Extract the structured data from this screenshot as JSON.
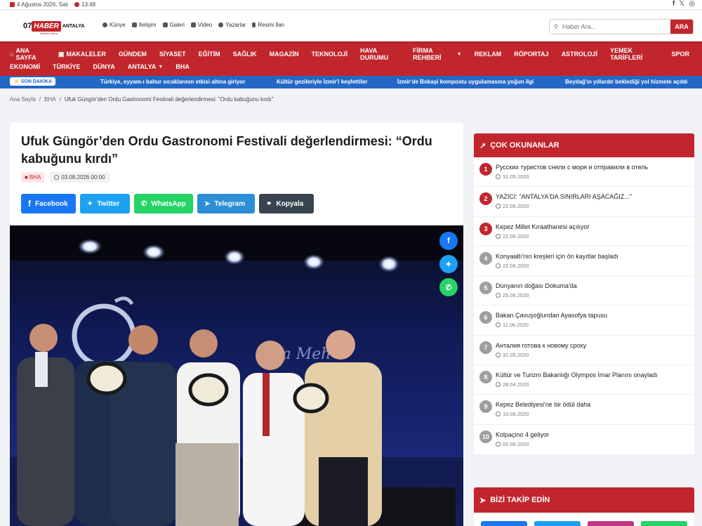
{
  "topbar": {
    "date": "4 Ağustos 2026, Salı",
    "time": "13:48"
  },
  "social_top": [
    "f",
    "𝕏",
    "◎"
  ],
  "logo": {
    "prefix": "07",
    "haber": "HABER",
    "suffix": "ANTALYA",
    "slogan": "haberin adresi"
  },
  "topnav": [
    "Künye",
    "İletişim",
    "Galeri",
    "Video",
    "Yazarlar",
    "Resmi İlan"
  ],
  "search": {
    "placeholder": "Haber Ara...",
    "button": "ARA"
  },
  "mainnav": {
    "row1": [
      "ANA SAYFA",
      "MAKALELER",
      "GÜNDEM",
      "SİYASET",
      "EĞİTİM",
      "SAĞLIK",
      "MAGAZİN",
      "TEKNOLOJİ",
      "HAVA DURUMU",
      "FİRMA REHBERİ",
      "REKLAM",
      "RÖPORTAJ",
      "ASTROLOJİ",
      "YEMEK TARİFLERİ",
      "SPOR"
    ],
    "row2": [
      "EKONOMİ",
      "TÜRKİYE",
      "DÜNYA",
      "ANTALYA",
      "BHA"
    ]
  },
  "ticker": {
    "label": "SON DAKİKA",
    "items": [
      "Türkiye, eyyam-ı bahur sıcaklarının etkisi altına giriyor",
      "Kültür gezileriyle İzmir'i keşfettiler",
      "İzmir'de Bokaşi kompostu uygulamasına yoğun ilgi",
      "Beydağ'ın yıllardır beklediği yol hizmete açıldı"
    ]
  },
  "breadcrumb": [
    "Ana Sayfa",
    "BHA",
    "Ufuk Güngör'den Ordu Gastronomi Festivali değerlendirmesi: \"Ordu kabuğunu kırdı\""
  ],
  "article": {
    "title": "Ufuk Güngör’den Ordu Gastronomi Festivali değerlendirmesi: “Ordu kabuğunu kırdı”",
    "category": "BHA",
    "date": "03.08.2026 00:00",
    "share": {
      "facebook": "Facebook",
      "twitter": "Twitter",
      "whatsapp": "WhatsApp",
      "telegram": "Telegram",
      "copy": "Kopyala"
    }
  },
  "popular": {
    "title": "ÇOK OKUNANLAR",
    "items": [
      {
        "n": "1",
        "title": "Русских туристов сняли с моря и отправили в отель",
        "date": "31.05.2020"
      },
      {
        "n": "2",
        "title": "YAZICI: \"ANTALYA'DA SINIRLARI AŞACAĞIZ...\"",
        "date": "22.06.2020"
      },
      {
        "n": "3",
        "title": "Kepez Millet Kıraathanesi açılıyor",
        "date": "22.06.2020"
      },
      {
        "n": "4",
        "title": "Konyaaltı'nın kreşleri için ön kayıtlar başladı",
        "date": "22.06.2020"
      },
      {
        "n": "5",
        "title": "Dünyanın doğası Dokuma'da",
        "date": "25.06.2020"
      },
      {
        "n": "6",
        "title": "Bakan Çavuşoğlundan Ayasofya tapusu",
        "date": "11.06.2020"
      },
      {
        "n": "7",
        "title": "Анталия готова к новому сроку",
        "date": "31.05.2020"
      },
      {
        "n": "8",
        "title": "Kültür ve Turizm Bakanlığı Olympos İmar Planını onayladı",
        "date": "28.04.2020"
      },
      {
        "n": "9",
        "title": "Kepez Belediyesi'ne bir ödül daha",
        "date": "10.06.2020"
      },
      {
        "n": "10",
        "title": "Kolpaçino 4 geliyor",
        "date": "05.06.2020"
      }
    ]
  },
  "follow": {
    "title": "BİZİ TAKİP EDİN"
  },
  "colors": {
    "brand": "#c0262c",
    "ticker": "#2468c5",
    "rank_top": "#c0262c",
    "rank_other": "#9e9e9e"
  }
}
